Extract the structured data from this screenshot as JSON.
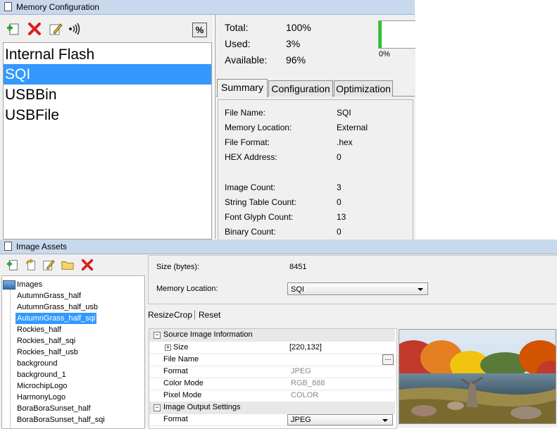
{
  "memory_config": {
    "title": "Memory Configuration",
    "percent_button": "%",
    "memory_list": [
      "Internal Flash",
      "SQI",
      "USBBin",
      "USBFile"
    ],
    "selected_memory": "SQI",
    "stats": {
      "total_label": "Total:",
      "total_value": "100%",
      "used_label": "Used:",
      "used_value": "3%",
      "available_label": "Available:",
      "available_value": "96%"
    },
    "usage_bar": {
      "label": "0%",
      "fill_fraction": 0.03,
      "fill_color": "#22cc22"
    },
    "tabs": [
      "Summary",
      "Configuration",
      "Optimization"
    ],
    "active_tab": "Summary",
    "summary": [
      {
        "label": "File Name:",
        "value": "SQI"
      },
      {
        "label": "Memory Location:",
        "value": "External"
      },
      {
        "label": "File Format:",
        "value": ".hex"
      },
      {
        "label": "HEX Address:",
        "value": "0"
      },
      {
        "label": "Image Count:",
        "value": "3"
      },
      {
        "label": "String Table Count:",
        "value": "0"
      },
      {
        "label": "Font Glyph Count:",
        "value": "13"
      },
      {
        "label": "Binary Count:",
        "value": "0"
      }
    ],
    "toolbar_icons": [
      "add-icon",
      "delete-icon",
      "edit-icon",
      "signal-icon"
    ]
  },
  "image_assets": {
    "title": "Image Assets",
    "toolbar_icons": [
      "add-icon",
      "import-icon",
      "edit-icon",
      "folder-icon",
      "delete-icon"
    ],
    "tree_root": "Images",
    "tree_items": [
      "AutumnGrass_half",
      "AutumnGrass_half_usb",
      "AutumnGrass_half_sqi",
      "Rockies_half",
      "Rockies_half_sqi",
      "Rockies_half_usb",
      "background",
      "background_1",
      "MicrochipLogo",
      "HarmonyLogo",
      "BoraBoraSunset_half",
      "BoraBoraSunset_half_sqi"
    ],
    "selected_item": "AutumnGrass_half_sqi",
    "size_label": "Size (bytes):",
    "size_value": "8451",
    "memory_location_label": "Memory Location:",
    "memory_location_value": "SQI",
    "links": [
      "Resize",
      "Crop",
      "Reset"
    ],
    "properties": {
      "source_category": "Source Image Information",
      "size_label": "Size",
      "size_value": "[220,132]",
      "file_name_label": "File Name",
      "file_name_value": "",
      "browse_button": "...",
      "format_label": "Format",
      "format_value": "JPEG",
      "color_mode_label": "Color Mode",
      "color_mode_value": "RGB_888",
      "pixel_mode_label": "Pixel Mode",
      "pixel_mode_value": "COLOR",
      "output_category": "Image Output Settings",
      "output_format_label": "Format",
      "output_format_value": "JPEG"
    }
  }
}
